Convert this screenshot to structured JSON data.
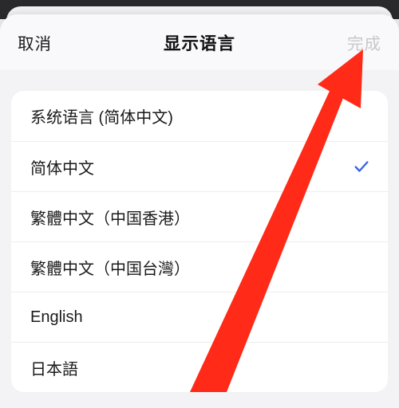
{
  "header": {
    "cancel_label": "取消",
    "title": "显示语言",
    "done_label": "完成"
  },
  "languages": [
    {
      "label": "系统语言 (简体中文)",
      "selected": false
    },
    {
      "label": "简体中文",
      "selected": true
    },
    {
      "label": "繁體中文（中国香港）",
      "selected": false
    },
    {
      "label": "繁體中文（中国台灣）",
      "selected": false
    },
    {
      "label": "English",
      "selected": false
    },
    {
      "label": "日本語",
      "selected": false
    }
  ],
  "colors": {
    "accent_check": "#3b63e6",
    "done_disabled": "#c7c7cc",
    "annotation_red": "#ff2a17"
  }
}
